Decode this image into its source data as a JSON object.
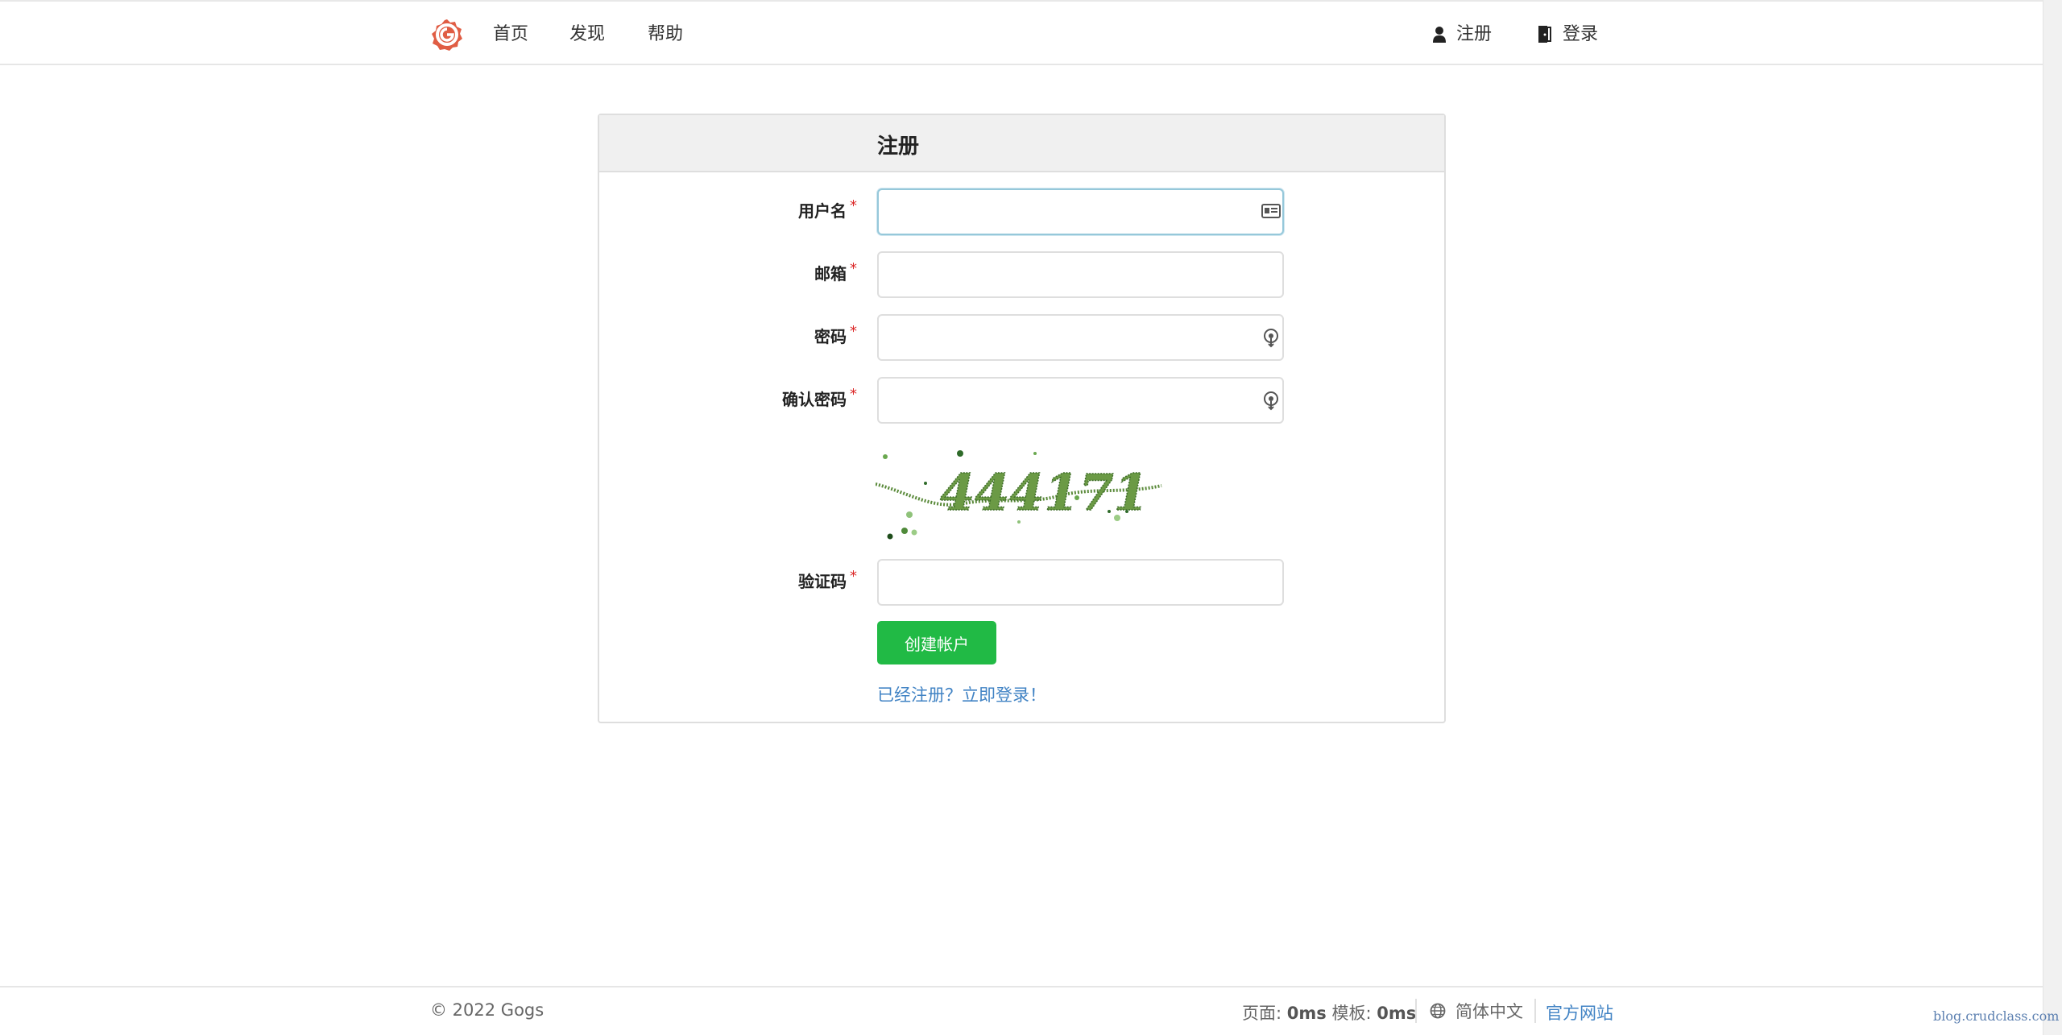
{
  "header": {
    "nav": {
      "home": "首页",
      "explore": "发现",
      "help": "帮助",
      "register": "注册",
      "login": "登录"
    }
  },
  "signup": {
    "title": "注册",
    "fields": {
      "username": {
        "label": "用户名",
        "value": ""
      },
      "email": {
        "label": "邮箱",
        "value": ""
      },
      "password": {
        "label": "密码",
        "value": ""
      },
      "confirm_password": {
        "label": "确认密码",
        "value": ""
      },
      "captcha": {
        "label": "验证码",
        "value": ""
      }
    },
    "required_mark": "*",
    "captcha_text": "444171",
    "submit_label": "创建帐户",
    "login_link": "已经注册？立即登录！"
  },
  "footer": {
    "copyright": "© 2022 Gogs",
    "page_label": "页面: ",
    "page_time": "0ms",
    "template_label": " 模板: ",
    "template_time": "0ms",
    "language": "简体中文",
    "official_site": "官方网站"
  },
  "watermark": "blog.crudclass.com",
  "colors": {
    "brand": "#e05d44",
    "primary_button": "#21ba45",
    "link": "#4183c4",
    "required": "#db2828"
  }
}
